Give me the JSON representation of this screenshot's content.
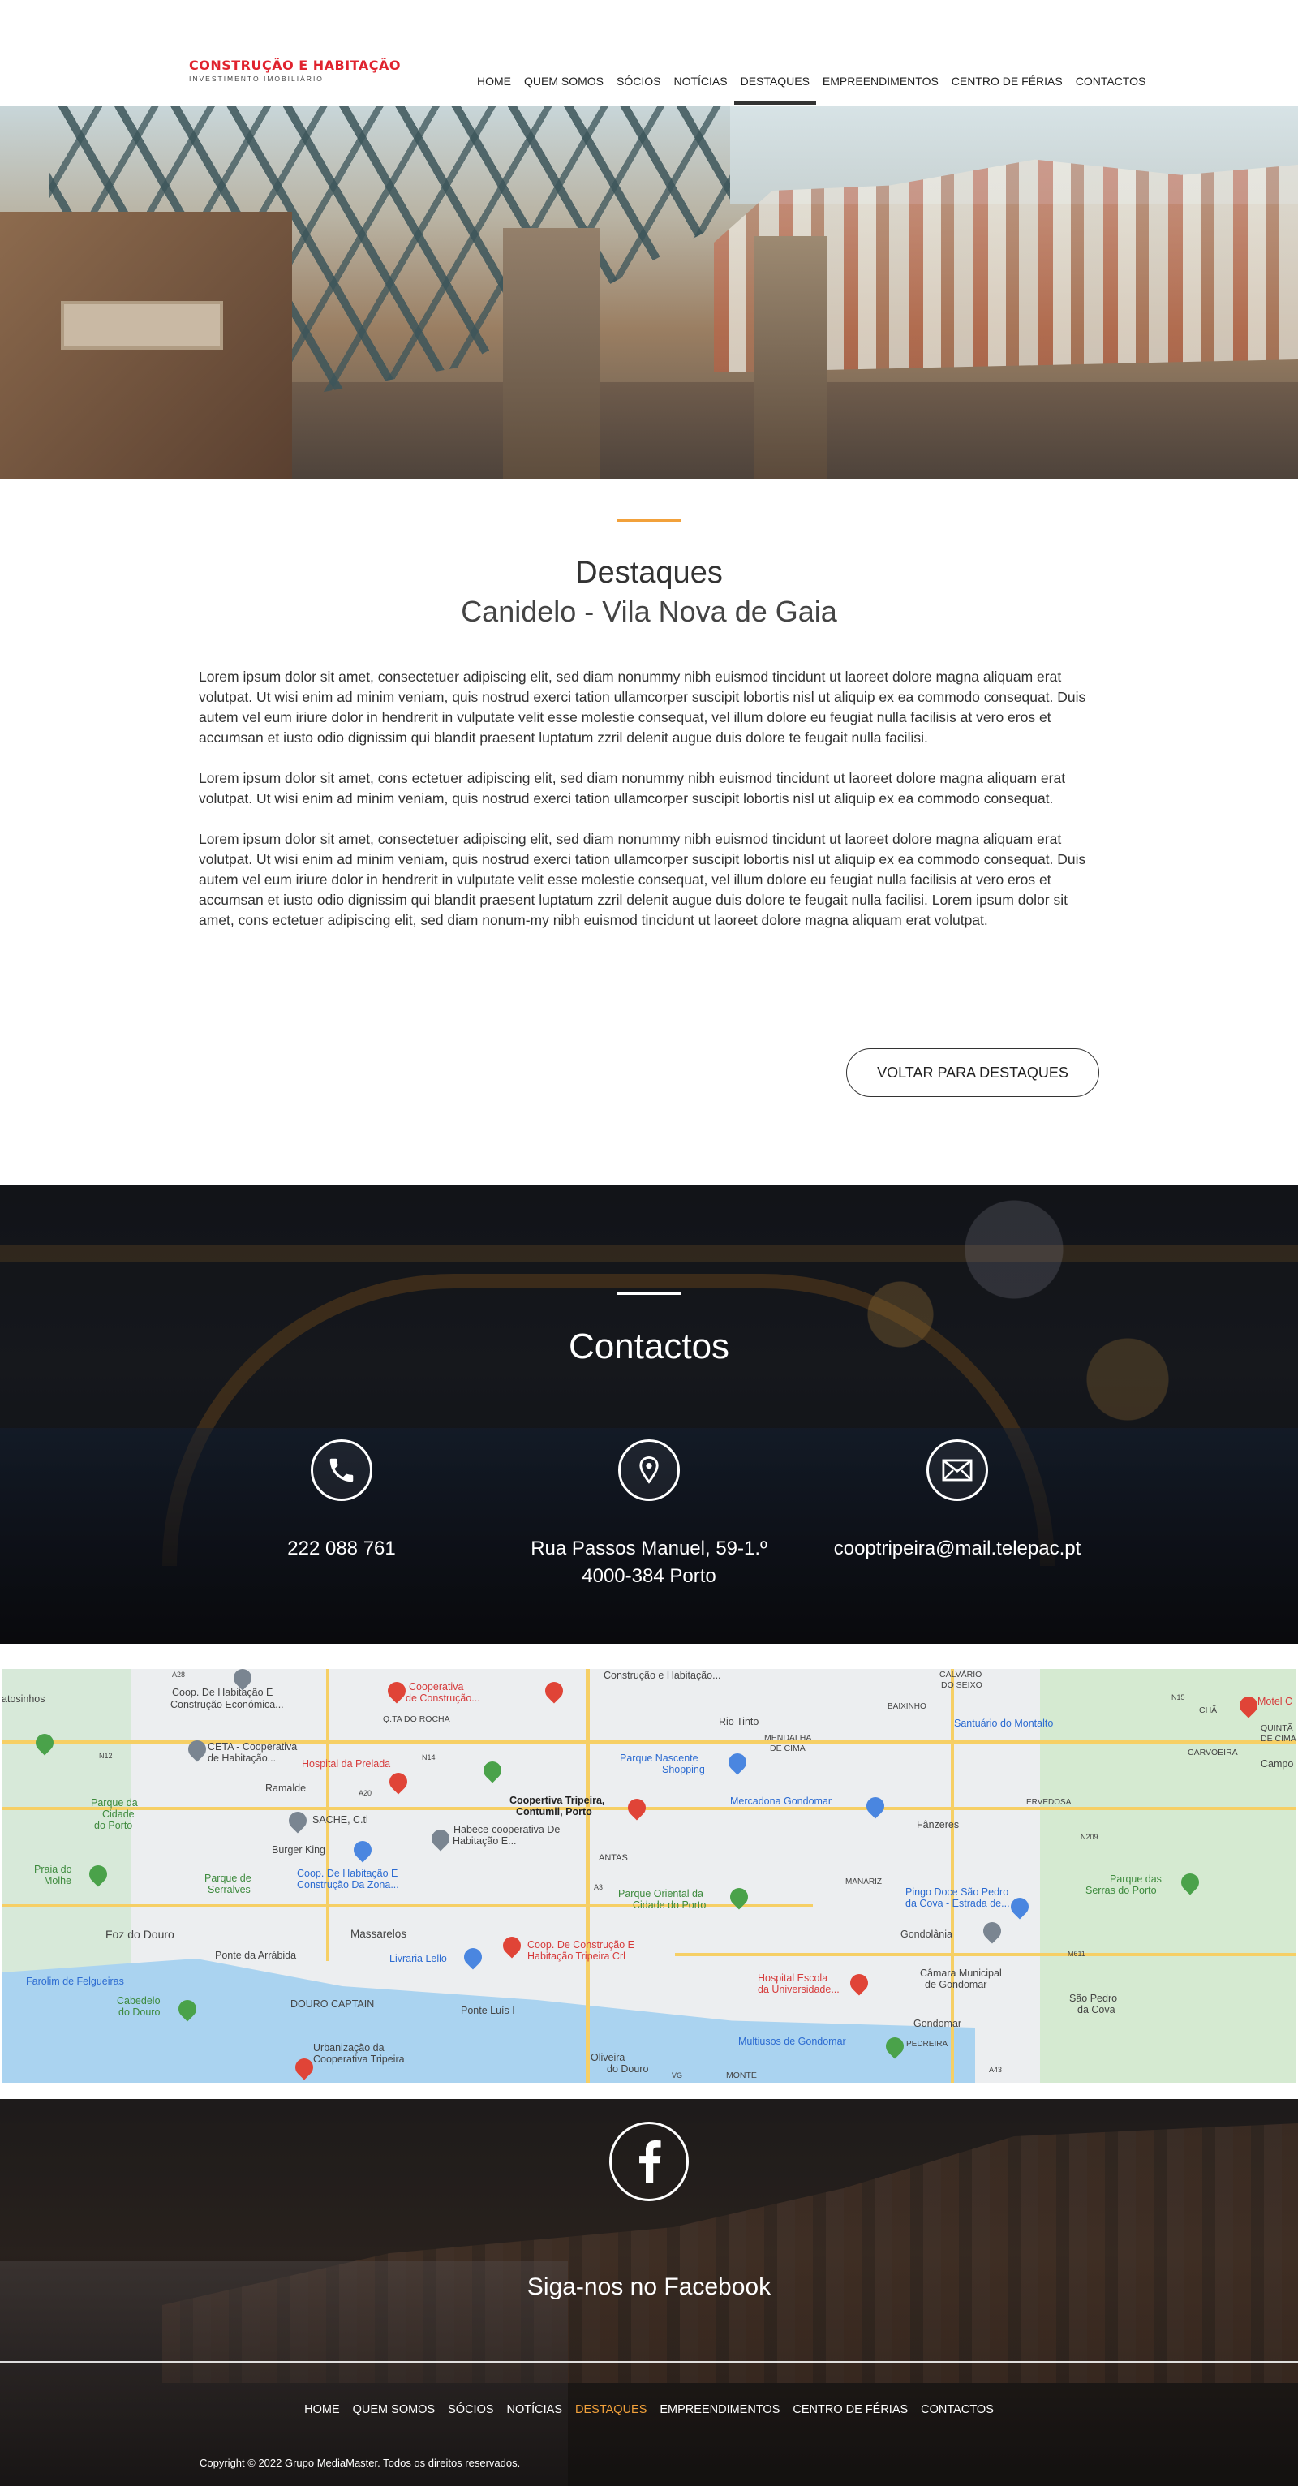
{
  "header": {
    "logo_title": "CONSTRUÇÃO E HABITAÇÃO",
    "logo_subtitle": "INVESTIMENTO IMOBILIÁRIO",
    "nav": [
      "HOME",
      "QUEM SOMOS",
      "SÓCIOS",
      "NOTÍCIAS",
      "DESTAQUES",
      "EMPREENDIMENTOS",
      "CENTRO DE FÉRIAS",
      "CONTACTOS"
    ],
    "active_nav": "DESTAQUES"
  },
  "main": {
    "title": "Destaques",
    "subtitle": "Canidelo - Vila Nova de Gaia",
    "paragraphs": [
      "Lorem ipsum dolor sit amet, consectetuer adipiscing elit, sed diam nonummy nibh euismod tincidunt ut laoreet dolore magna aliquam erat volutpat. Ut wisi enim ad minim veniam, quis nostrud exerci tation ullamcorper suscipit lobortis nisl ut aliquip ex ea commodo consequat. Duis autem vel eum iriure dolor in hendrerit in vulputate velit esse molestie consequat, vel illum dolore eu feugiat nulla facilisis at vero eros et accumsan et iusto odio dignissim qui blandit praesent luptatum zzril delenit augue duis dolore te feugait nulla facilisi.",
      "Lorem ipsum dolor sit amet, cons ectetuer adipiscing elit, sed diam nonummy nibh euismod tincidunt ut laoreet dolore magna aliquam erat volutpat. Ut wisi enim ad minim veniam, quis nostrud exerci tation ullamcorper suscipit lobortis nisl ut aliquip ex ea commodo consequat.",
      "Lorem ipsum dolor sit amet, consectetuer adipiscing elit, sed diam nonummy nibh euismod tincidunt ut laoreet dolore magna aliquam erat volutpat. Ut wisi enim ad minim veniam, quis nostrud exerci tation ullamcorper suscipit lobortis nisl ut aliquip ex ea commodo consequat. Duis autem vel eum iriure dolor in hendrerit in vulputate velit esse molestie consequat, vel illum dolore eu feugiat nulla facilisis at vero eros et accumsan et iusto odio dignissim qui blandit praesent luptatum zzril delenit augue duis dolore te feugait nulla facilisi. Lorem ipsum dolor sit amet, cons ectetuer adipiscing elit, sed diam nonum-my nibh euismod tincidunt ut laoreet dolore magna aliquam erat volutpat."
    ],
    "back_button": "VOLTAR PARA DESTAQUES"
  },
  "contact": {
    "title": "Contactos",
    "phone": "222 088 761",
    "address_line1": "Rua Passos Manuel, 59-1.º",
    "address_line2": "4000-384 Porto",
    "email": "cooptripeira@mail.telepac.pt",
    "icons": [
      "phone-icon",
      "location-pin-icon",
      "envelope-icon"
    ]
  },
  "map": {
    "labels": [
      "atosinhos",
      "Coop. De Habitação E",
      "Construção Económica...",
      "Cooperativa",
      "de Construção...",
      "Q.TA DO ROCHA",
      "Construção e Habitação...",
      "Rio Tinto",
      "MENDALHA",
      "DE CIMA",
      "CALVÁRIO",
      "DO SEIXO",
      "BAIXINHO",
      "Santuário do Montalto",
      "CHÃ",
      "QUINTÃ",
      "DE CIMA",
      "CARVOEIRA",
      "Campo",
      "Motel C",
      "CETA - Cooperativa",
      "de Habitação...",
      "Hospital da Prelada",
      "Parque Nascente",
      "Shopping",
      "Ramalde",
      "Parque da",
      "Cidade",
      "do Porto",
      "Coopertiva Tripeira,",
      "Contumil, Porto",
      "Mercadona Gondomar",
      "Fânzeres",
      "ERVEDOSA",
      "SACHE, C.ti",
      "Habece-cooperativa De",
      "Habitação E...",
      "Burger King",
      "ANTAS",
      "MANARIZ",
      "Parque das",
      "Serras do Porto",
      "Praia do",
      "Molhe",
      "Parque de",
      "Serralves",
      "Coop. De Habitação E",
      "Construção Da Zona...",
      "Parque Oriental da",
      "Cidade do Porto",
      "Pingo Doce São Pedro",
      "da Cova - Estrada de...",
      "Foz do Douro",
      "Massarelos",
      "Coop. De Construção E",
      "Habitação Tripeira Crl",
      "Gondolânia",
      "Farolim de Felgueiras",
      "Ponte da Arrábida",
      "Livraria Lello",
      "Hospital Escola",
      "da Universidade...",
      "Câmara Municipal",
      "de Gondomar",
      "São Pedro",
      "da Cova",
      "Cabedelo",
      "do Douro",
      "DOURO CAPTAIN",
      "Ponte Luís I",
      "Gondomar",
      "Multiusos de Gondomar",
      "PEDREIRA",
      "Urbanização da",
      "Cooperativa Tripeira",
      "Oliveira",
      "do Douro",
      "MONTE",
      "N12",
      "A28",
      "A20",
      "N14",
      "N209",
      "A43",
      "M611",
      "N15",
      "A3",
      "VG"
    ]
  },
  "footer": {
    "facebook_text": "Siga-nos no Facebook",
    "nav": [
      "HOME",
      "QUEM SOMOS",
      "SÓCIOS",
      "NOTÍCIAS",
      "DESTAQUES",
      "EMPREENDIMENTOS",
      "CENTRO DE FÉRIAS",
      "CONTACTOS"
    ],
    "active_nav": "DESTAQUES",
    "copyright": "Copyright © 2022 Grupo MediaMaster. Todos os direitos reservados."
  },
  "colors": {
    "brand_red": "#e0232e",
    "accent_orange": "#f2a13b",
    "text_dark": "#333333",
    "map_blue": "#4a86e0",
    "map_red": "#e04437"
  }
}
